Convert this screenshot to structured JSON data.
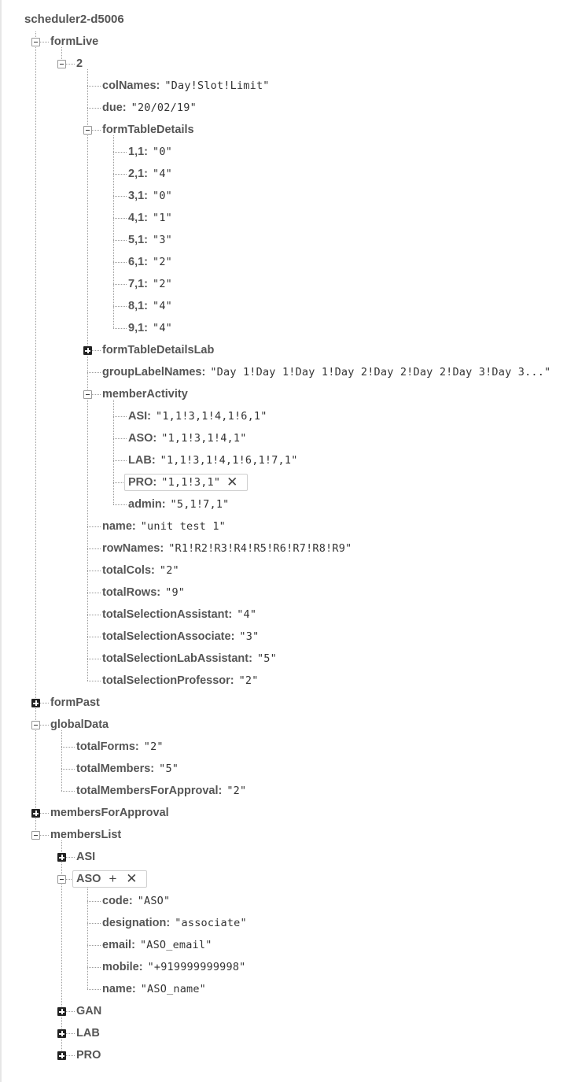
{
  "root": "scheduler2-d5006",
  "nodes": [
    {
      "key": "formLive",
      "depth": 0,
      "toggle": "minus"
    },
    {
      "key": "2",
      "depth": 1,
      "toggle": "minus"
    },
    {
      "key": "colNames",
      "depth": 2,
      "value": "\"Day!Slot!Limit\""
    },
    {
      "key": "due",
      "depth": 2,
      "value": "\"20/02/19\""
    },
    {
      "key": "formTableDetails",
      "depth": 2,
      "toggle": "minus"
    },
    {
      "key": "1,1",
      "depth": 3,
      "value": "\"0\""
    },
    {
      "key": "2,1",
      "depth": 3,
      "value": "\"4\""
    },
    {
      "key": "3,1",
      "depth": 3,
      "value": "\"0\""
    },
    {
      "key": "4,1",
      "depth": 3,
      "value": "\"1\""
    },
    {
      "key": "5,1",
      "depth": 3,
      "value": "\"3\""
    },
    {
      "key": "6,1",
      "depth": 3,
      "value": "\"2\""
    },
    {
      "key": "7,1",
      "depth": 3,
      "value": "\"2\""
    },
    {
      "key": "8,1",
      "depth": 3,
      "value": "\"4\""
    },
    {
      "key": "9,1",
      "depth": 3,
      "value": "\"4\""
    },
    {
      "key": "formTableDetailsLab",
      "depth": 2,
      "toggle": "plus"
    },
    {
      "key": "groupLabelNames",
      "depth": 2,
      "value": "\"Day 1!Day 1!Day 1!Day 2!Day 2!Day 2!Day 3!Day 3...\""
    },
    {
      "key": "memberActivity",
      "depth": 2,
      "toggle": "minus"
    },
    {
      "key": "ASI",
      "depth": 3,
      "value": "\"1,1!3,1!4,1!6,1\""
    },
    {
      "key": "ASO",
      "depth": 3,
      "value": "\"1,1!3,1!4,1\""
    },
    {
      "key": "LAB",
      "depth": 3,
      "value": "\"1,1!3,1!4,1!6,1!7,1\""
    },
    {
      "key": "PRO",
      "depth": 3,
      "value": "\"1,1!3,1\"",
      "editing": true,
      "actions": [
        "✕"
      ]
    },
    {
      "key": "admin",
      "depth": 3,
      "value": "\"5,1!7,1\""
    },
    {
      "key": "name",
      "depth": 2,
      "value": "\"unit test 1\""
    },
    {
      "key": "rowNames",
      "depth": 2,
      "value": "\"R1!R2!R3!R4!R5!R6!R7!R8!R9\""
    },
    {
      "key": "totalCols",
      "depth": 2,
      "value": "\"2\""
    },
    {
      "key": "totalRows",
      "depth": 2,
      "value": "\"9\""
    },
    {
      "key": "totalSelectionAssistant",
      "depth": 2,
      "value": "\"4\""
    },
    {
      "key": "totalSelectionAssociate",
      "depth": 2,
      "value": "\"3\""
    },
    {
      "key": "totalSelectionLabAssistant",
      "depth": 2,
      "value": "\"5\""
    },
    {
      "key": "totalSelectionProfessor",
      "depth": 2,
      "value": "\"2\""
    },
    {
      "key": "formPast",
      "depth": 0,
      "toggle": "plus"
    },
    {
      "key": "globalData",
      "depth": 0,
      "toggle": "minus"
    },
    {
      "key": "totalForms",
      "depth": 1,
      "value": "\"2\""
    },
    {
      "key": "totalMembers",
      "depth": 1,
      "value": "\"5\""
    },
    {
      "key": "totalMembersForApproval",
      "depth": 1,
      "value": "\"2\""
    },
    {
      "key": "membersForApproval",
      "depth": 0,
      "toggle": "plus"
    },
    {
      "key": "membersList",
      "depth": 0,
      "toggle": "minus"
    },
    {
      "key": "ASI",
      "depth": 1,
      "toggle": "plus"
    },
    {
      "key": "ASO",
      "depth": 1,
      "toggle": "minus",
      "editing": true,
      "actions": [
        "+",
        "✕"
      ]
    },
    {
      "key": "code",
      "depth": 2,
      "value": "\"ASO\""
    },
    {
      "key": "designation",
      "depth": 2,
      "value": "\"associate\""
    },
    {
      "key": "email",
      "depth": 2,
      "value": "\"ASO_email\""
    },
    {
      "key": "mobile",
      "depth": 2,
      "value": "\"+919999999998\""
    },
    {
      "key": "name",
      "depth": 2,
      "value": "\"ASO_name\""
    },
    {
      "key": "GAN",
      "depth": 1,
      "toggle": "plus"
    },
    {
      "key": "LAB",
      "depth": 1,
      "toggle": "plus"
    },
    {
      "key": "PRO",
      "depth": 1,
      "toggle": "plus"
    }
  ]
}
